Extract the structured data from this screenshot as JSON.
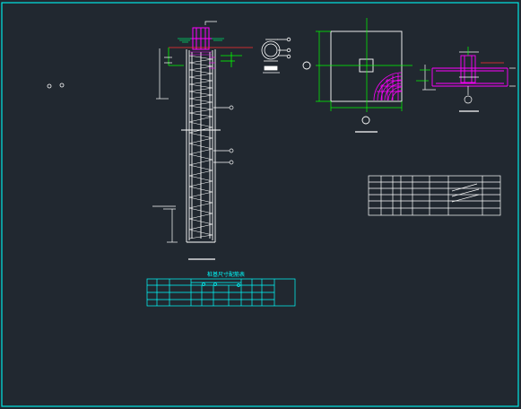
{
  "drawing": {
    "pile_schedule_title": "桩基尺寸配筋表",
    "colors": {
      "background": "#212830",
      "frame": "#00e5e5",
      "lines": "#ffffff",
      "accent": "#ff00ff",
      "dimension": "#00ff00",
      "hatch": "#00cc66",
      "red": "#ff3030",
      "table_cyan": "#00ffff"
    }
  }
}
